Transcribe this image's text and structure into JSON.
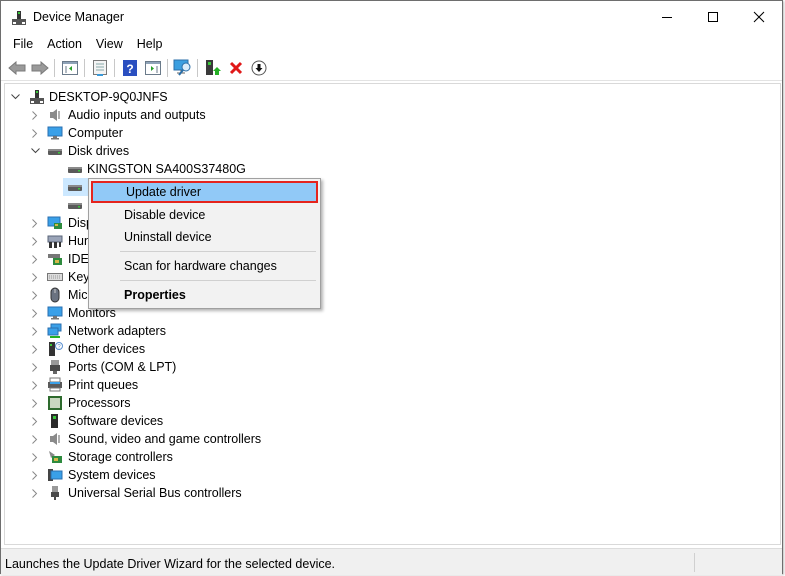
{
  "window": {
    "title": "Device Manager",
    "controls": {
      "minimize": "minimize",
      "maximize": "maximize",
      "close": "close"
    }
  },
  "menubar": {
    "items": [
      "File",
      "Action",
      "View",
      "Help"
    ]
  },
  "toolbar": {
    "buttons": [
      {
        "icon": "back-arrow-icon"
      },
      {
        "icon": "forward-arrow-icon"
      },
      {
        "icon": "show-hide-console-tree-icon"
      },
      {
        "icon": "properties-icon"
      },
      {
        "icon": "help-icon"
      },
      {
        "icon": "show-action-pane-icon"
      },
      {
        "icon": "scan-hardware-icon"
      },
      {
        "icon": "update-driver-icon"
      },
      {
        "icon": "uninstall-device-icon"
      },
      {
        "icon": "disable-device-icon"
      }
    ]
  },
  "tree": {
    "root": "DESKTOP-9Q0JNFS",
    "categories": [
      {
        "label": "Audio inputs and outputs",
        "icon": "speaker-icon",
        "expanded": false
      },
      {
        "label": "Computer",
        "icon": "monitor-icon",
        "expanded": false
      },
      {
        "label": "Disk drives",
        "icon": "disk-drive-icon",
        "expanded": true,
        "children": [
          {
            "label": "KINGSTON SA400S37480G",
            "icon": "disk-drive-icon"
          },
          {
            "label": "",
            "icon": "disk-drive-icon",
            "selected": true
          },
          {
            "label": "",
            "icon": "disk-drive-icon"
          }
        ]
      },
      {
        "label": "Disp",
        "icon": "display-adapter-icon",
        "expanded": false
      },
      {
        "label": "Hun",
        "icon": "hid-icon",
        "expanded": false
      },
      {
        "label": "IDE ",
        "icon": "ide-controller-icon",
        "expanded": false
      },
      {
        "label": "Keyl",
        "icon": "keyboard-icon",
        "expanded": false
      },
      {
        "label": "Mic",
        "icon": "mouse-icon",
        "expanded": false
      },
      {
        "label": "Monitors",
        "icon": "monitor-icon",
        "expanded": false
      },
      {
        "label": "Network adapters",
        "icon": "network-icon",
        "expanded": false
      },
      {
        "label": "Other devices",
        "icon": "unknown-device-icon",
        "expanded": false
      },
      {
        "label": "Ports (COM & LPT)",
        "icon": "port-icon",
        "expanded": false
      },
      {
        "label": "Print queues",
        "icon": "printer-icon",
        "expanded": false
      },
      {
        "label": "Processors",
        "icon": "processor-icon",
        "expanded": false
      },
      {
        "label": "Software devices",
        "icon": "software-device-icon",
        "expanded": false
      },
      {
        "label": "Sound, video and game controllers",
        "icon": "speaker-icon",
        "expanded": false
      },
      {
        "label": "Storage controllers",
        "icon": "storage-controller-icon",
        "expanded": false
      },
      {
        "label": "System devices",
        "icon": "system-device-icon",
        "expanded": false
      },
      {
        "label": "Universal Serial Bus controllers",
        "icon": "usb-icon",
        "expanded": false
      }
    ]
  },
  "context_menu": {
    "items": [
      {
        "label": "Update driver",
        "highlighted": true
      },
      {
        "label": "Disable device"
      },
      {
        "label": "Uninstall device"
      },
      {
        "separator": true
      },
      {
        "label": "Scan for hardware changes"
      },
      {
        "separator": true
      },
      {
        "label": "Properties",
        "bold": true
      }
    ],
    "highlight_color": "#91c9f7",
    "annotation_border_color": "#e5241d"
  },
  "statusbar": {
    "text": "Launches the Update Driver Wizard for the selected device."
  }
}
